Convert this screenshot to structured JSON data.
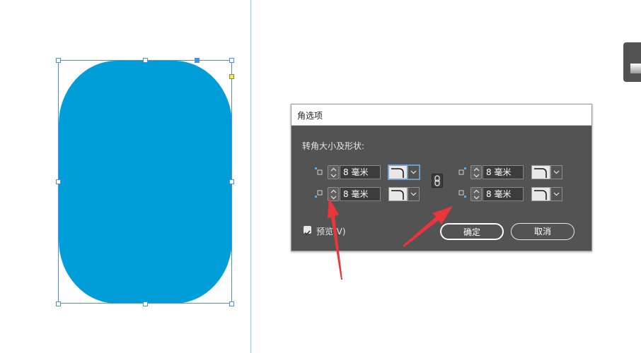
{
  "dialog": {
    "title": "角选项",
    "section_label": "转角大小及形状:",
    "corners": {
      "top_left": {
        "value": "8 毫米"
      },
      "bottom_left": {
        "value": "8 毫米"
      },
      "top_right": {
        "value": "8 毫米"
      },
      "bottom_right": {
        "value": "8 毫米"
      }
    },
    "preview_label": "预览(V)",
    "preview_checked": true,
    "ok_label": "确定",
    "cancel_label": "取消"
  },
  "colors": {
    "shape_fill": "#009ed8",
    "selection": "#4a8ee6",
    "dialog_bg": "#535353",
    "annotation_arrow": "#e8363a"
  }
}
